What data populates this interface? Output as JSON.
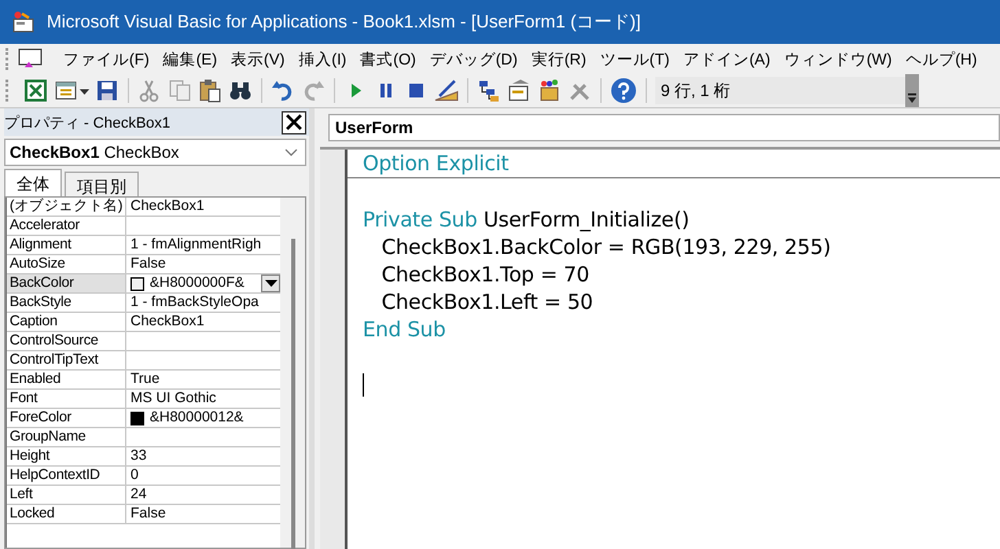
{
  "window": {
    "title": "Microsoft Visual Basic for Applications - Book1.xlsm - [UserForm1 (コード)]"
  },
  "menu": [
    "ファイル(F)",
    "編集(E)",
    "表示(V)",
    "挿入(I)",
    "書式(O)",
    "デバッグ(D)",
    "実行(R)",
    "ツール(T)",
    "アドイン(A)",
    "ウィンドウ(W)",
    "ヘルプ(H)"
  ],
  "toolbar": {
    "position": "9 行, 1 桁"
  },
  "properties": {
    "title": "プロパティ - CheckBox1",
    "object": {
      "name": "CheckBox1",
      "type": "CheckBox"
    },
    "tabs": [
      {
        "label": "全体",
        "selected": true
      },
      {
        "label": "項目別",
        "selected": false
      }
    ],
    "rows": [
      {
        "name": "(オブジェクト名)",
        "value": "CheckBox1",
        "selected": false
      },
      {
        "name": "Accelerator",
        "selected": false
      },
      {
        "name": "Alignment",
        "value": "1 - fmAlignmentRigh",
        "selected": false
      },
      {
        "name": "AutoSize",
        "value": "False",
        "selected": false
      },
      {
        "name": "BackColor",
        "value": "&H8000000F&",
        "color": "#f0f0f0",
        "selected": true
      },
      {
        "name": "BackStyle",
        "value": "1 - fmBackStyleOpa",
        "selected": false
      },
      {
        "name": "Caption",
        "value": "CheckBox1",
        "selected": false
      },
      {
        "name": "ControlSource",
        "selected": false
      },
      {
        "name": "ControlTipText",
        "selected": false
      },
      {
        "name": "Enabled",
        "value": "True",
        "selected": false
      },
      {
        "name": "Font",
        "value": "MS UI Gothic",
        "selected": false
      },
      {
        "name": "ForeColor",
        "value": "&H80000012&",
        "color": "#000000",
        "selected": false
      },
      {
        "name": "GroupName",
        "selected": false
      },
      {
        "name": "Height",
        "value": "33",
        "selected": false
      },
      {
        "name": "HelpContextID",
        "value": "0",
        "selected": false
      },
      {
        "name": "Left",
        "value": "24",
        "selected": false
      },
      {
        "name": "Locked",
        "value": "False",
        "selected": false
      }
    ]
  },
  "code": {
    "object": "UserForm",
    "procedures": [
      [
        [
          {
            "text": "Option Explicit",
            "kind": "keyword"
          }
        ]
      ],
      [
        [
          {
            "text": "Private Sub",
            "kind": "keyword"
          },
          {
            "text": " UserForm_Initialize()",
            "kind": "plain"
          }
        ],
        [
          {
            "text": "   CheckBox1.BackColor = RGB(193, 229, 255)",
            "kind": "plain"
          }
        ],
        [
          {
            "text": "   CheckBox1.Top = 70",
            "kind": "plain"
          }
        ],
        [
          {
            "text": "   CheckBox1.Left = 50",
            "kind": "plain"
          }
        ],
        [
          {
            "text": "End Sub",
            "kind": "keyword"
          }
        ]
      ]
    ]
  }
}
